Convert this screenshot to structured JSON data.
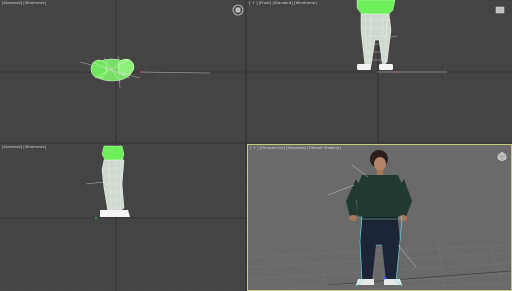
{
  "viewports": {
    "top": {
      "label": "[Standard] [Wireframe]"
    },
    "front": {
      "label": "[ + ] [Front] [Standard] [Wireframe]"
    },
    "left": {
      "label": "[Standard] [Wireframe]"
    },
    "perspective": {
      "label": "[ + ] [Perspective] [Standard] [Default Shading]"
    }
  },
  "icons": [
    "viewcube-icon",
    "viewcube-icon",
    "viewcube-icon"
  ],
  "colors": {
    "viewport_bg": "#444444",
    "perspective_bg": "#6a6a6a",
    "active_border": "#c8c879",
    "grid_line": "#4e4e4e",
    "grid_major": "#2f2f2f",
    "selection_green": "#5cf24a"
  }
}
